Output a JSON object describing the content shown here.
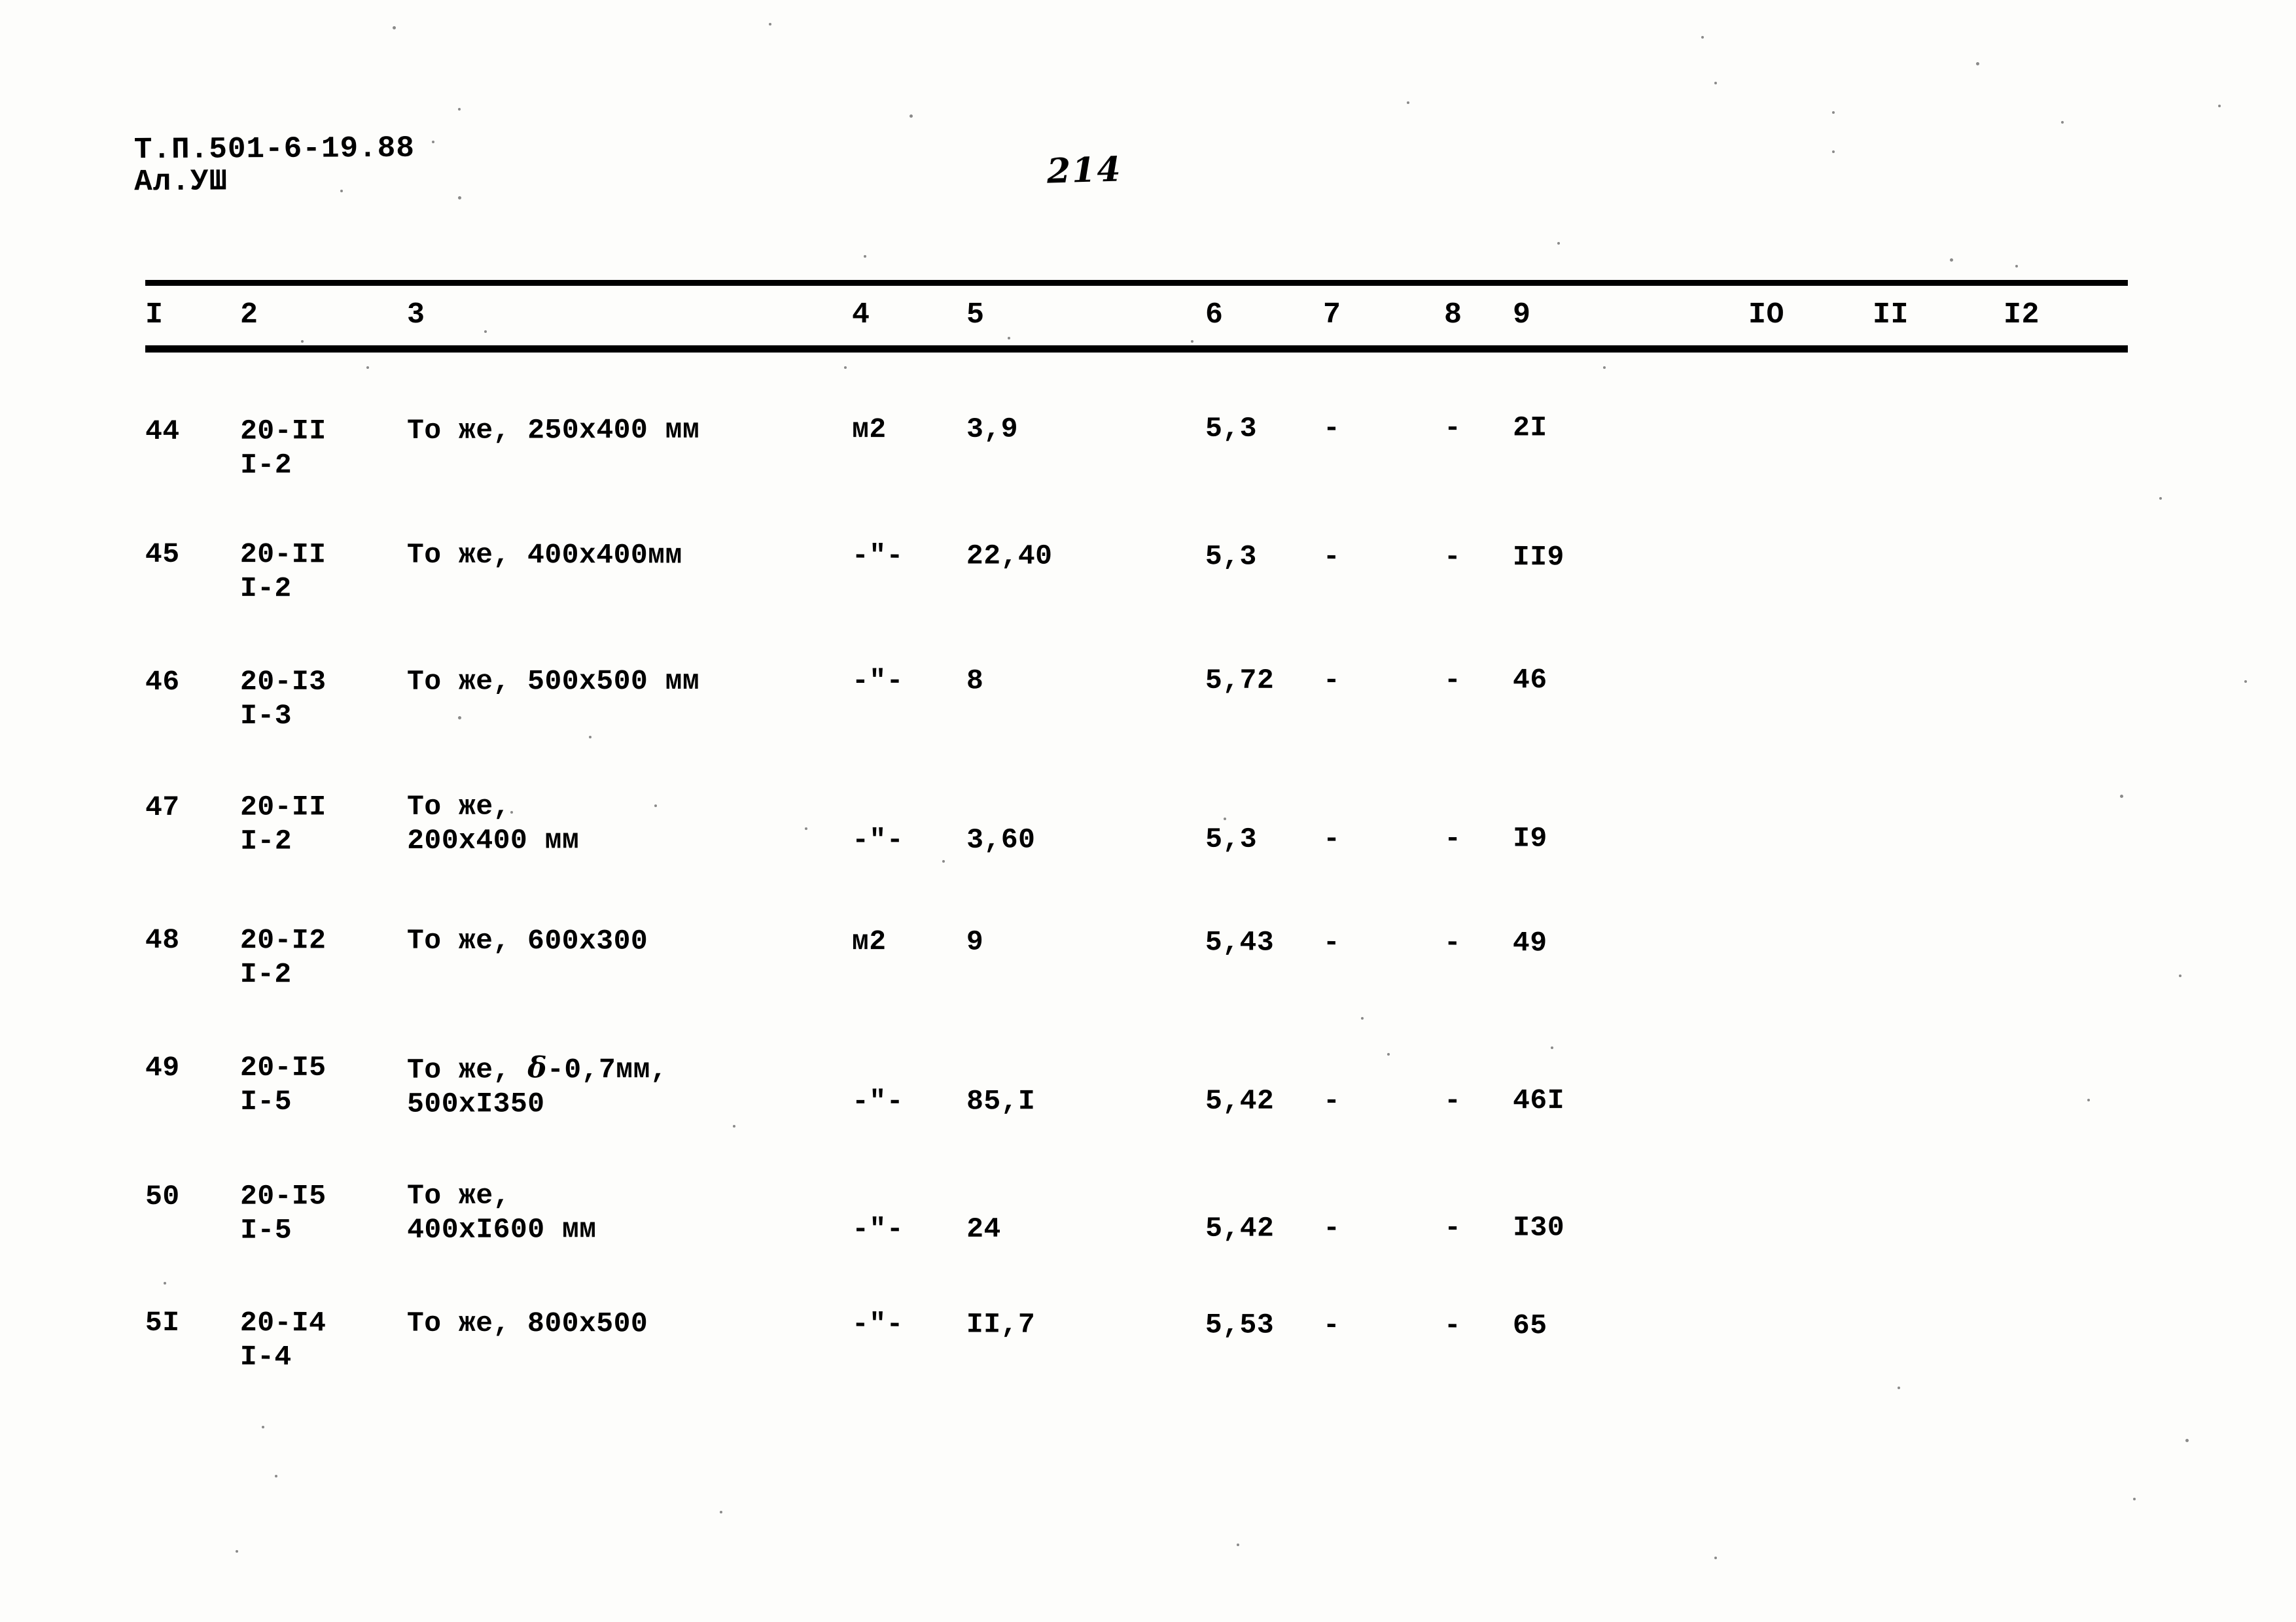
{
  "document": {
    "stamp_line1": "Т.П.501-6-19.88",
    "stamp_line2": "Ал.УШ",
    "page_number": "214"
  },
  "table": {
    "column_headers": [
      "I",
      "2",
      "3",
      "4",
      "5",
      "6",
      "7",
      "8",
      "9",
      "IO",
      "II",
      "I2"
    ],
    "rows": [
      {
        "num": "44",
        "code_top": "20-II",
        "code_bottom": "I-2",
        "desc_line1": "То же, 250x400 мм",
        "desc_line2": "",
        "unit": "м2",
        "qty": "3,9",
        "mass": "5,3",
        "c7": "-",
        "c8": "-",
        "c9": "2I",
        "c10": "",
        "c11": "",
        "c12": ""
      },
      {
        "num": "45",
        "code_top": "20-II",
        "code_bottom": "I-2",
        "desc_line1": "То же, 400x400мм",
        "desc_line2": "",
        "unit": "-\"-",
        "qty": "22,40",
        "mass": "5,3",
        "c7": "-",
        "c8": "-",
        "c9": "II9",
        "c10": "",
        "c11": "",
        "c12": ""
      },
      {
        "num": "46",
        "code_top": "20-I3",
        "code_bottom": "I-3",
        "desc_line1": "То же, 500x500 мм",
        "desc_line2": "",
        "unit": "-\"-",
        "qty": "8",
        "mass": "5,72",
        "c7": "-",
        "c8": "-",
        "c9": "46",
        "c10": "",
        "c11": "",
        "c12": ""
      },
      {
        "num": "47",
        "code_top": "20-II",
        "code_bottom": "I-2",
        "desc_line1": "То же,",
        "desc_line2": "200x400 мм",
        "unit": "-\"-",
        "qty": "3,60",
        "mass": "5,3",
        "c7": "-",
        "c8": "-",
        "c9": "I9",
        "c10": "",
        "c11": "",
        "c12": ""
      },
      {
        "num": "48",
        "code_top": "20-I2",
        "code_bottom": "I-2",
        "desc_line1": "То же, 600x300",
        "desc_line2": "",
        "unit": "м2",
        "qty": "9",
        "mass": "5,43",
        "c7": "-",
        "c8": "-",
        "c9": "49",
        "c10": "",
        "c11": "",
        "c12": ""
      },
      {
        "num": "49",
        "code_top": "20-I5",
        "code_bottom": "I-5",
        "desc_line1": "То же, δ-0,7мм,",
        "desc_line2": "500xI350",
        "unit": "-\"-",
        "qty": "85,I",
        "mass": "5,42",
        "c7": "-",
        "c8": "-",
        "c9": "46I",
        "c10": "",
        "c11": "",
        "c12": ""
      },
      {
        "num": "50",
        "code_top": "20-I5",
        "code_bottom": "I-5",
        "desc_line1": "То же,",
        "desc_line2": "400xI600 мм",
        "unit": "-\"-",
        "qty": "24",
        "mass": "5,42",
        "c7": "-",
        "c8": "-",
        "c9": "I30",
        "c10": "",
        "c11": "",
        "c12": ""
      },
      {
        "num": "5I",
        "code_top": "20-I4",
        "code_bottom": "I-4",
        "desc_line1": "То же, 800x500",
        "desc_line2": "",
        "unit": "-\"-",
        "qty": "II,7",
        "mass": "5,53",
        "c7": "-",
        "c8": "-",
        "c9": "65",
        "c10": "",
        "c11": "",
        "c12": ""
      }
    ]
  }
}
